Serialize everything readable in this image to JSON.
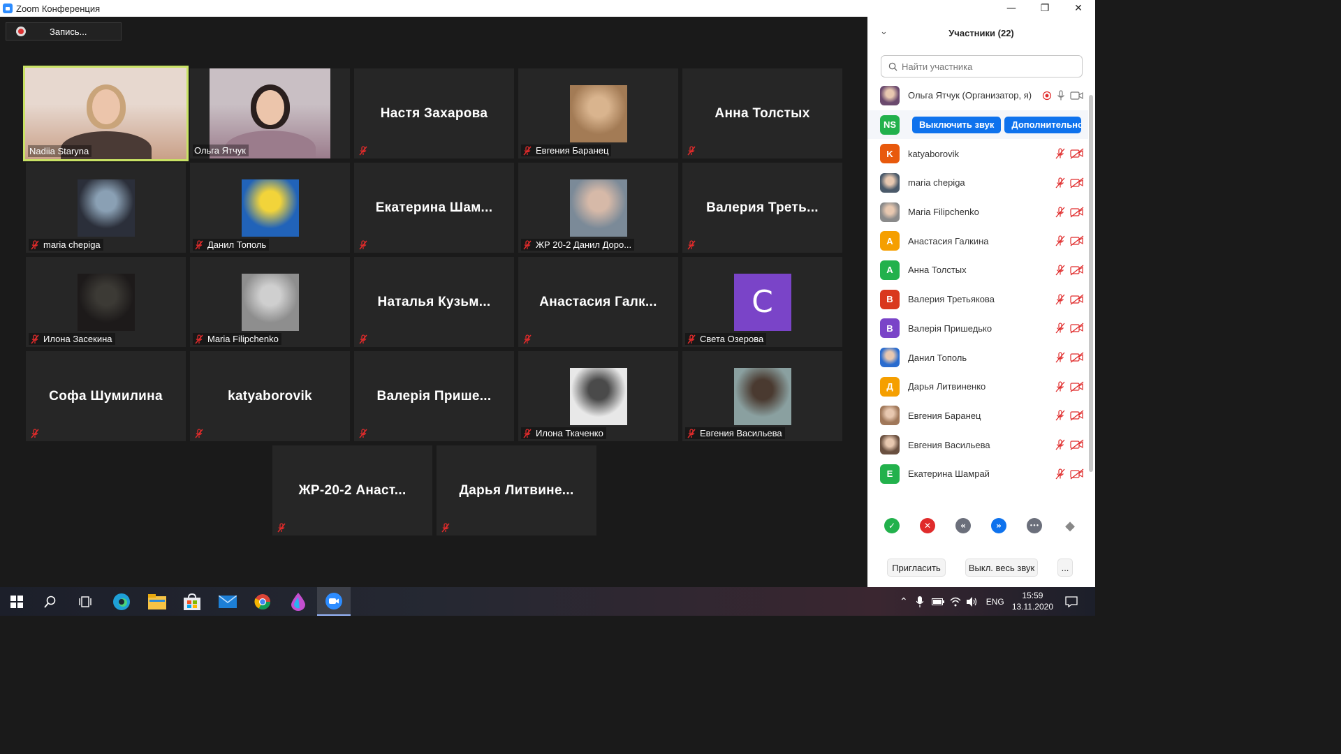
{
  "window": {
    "title": "Zoom Конференция",
    "minimize_glyph": "—",
    "restore_glyph": "❐",
    "close_glyph": "✕"
  },
  "recording": {
    "label": "Запись..."
  },
  "tiles": [
    {
      "id": "nadiia",
      "name": "Nadiia Staryna",
      "type": "video",
      "active": true,
      "muted": false
    },
    {
      "id": "olga",
      "name": "Ольга Ятчук",
      "type": "video",
      "muted": false
    },
    {
      "id": "nastya",
      "name": "Настя Захарова",
      "type": "name",
      "muted": true
    },
    {
      "id": "evgeniya-b",
      "name": "Евгения Баранец",
      "type": "photo",
      "muted": true
    },
    {
      "id": "anna",
      "name": "Анна Толстых",
      "type": "name",
      "muted": true
    },
    {
      "id": "maria-ch",
      "name": "maria chepiga",
      "type": "photo",
      "muted": true
    },
    {
      "id": "danil",
      "name": "Данил Тополь",
      "type": "photo",
      "muted": true
    },
    {
      "id": "ekaterina",
      "name": "Екатерина  Шам...",
      "type": "name",
      "muted": true
    },
    {
      "id": "zhr-danil",
      "name": "ЖР 20-2 Данил Доро...",
      "type": "photo",
      "muted": true
    },
    {
      "id": "valeriya-t",
      "name": "Валерия  Треть...",
      "type": "name",
      "muted": true
    },
    {
      "id": "ilona-z",
      "name": "Илона Засекина",
      "type": "photo",
      "muted": true
    },
    {
      "id": "maria-f",
      "name": "Maria Filipchenko",
      "type": "photo",
      "muted": true
    },
    {
      "id": "natalya",
      "name": "Наталья  Кузьм...",
      "type": "name",
      "muted": true
    },
    {
      "id": "anastasiya-g",
      "name": "Анастасия  Галк...",
      "type": "name",
      "muted": true
    },
    {
      "id": "sveta",
      "name": "Света Озерова",
      "type": "letter",
      "letter": "C",
      "muted": true
    },
    {
      "id": "sofa",
      "name": "Софа Шумилина",
      "type": "name",
      "muted": true
    },
    {
      "id": "katya",
      "name": "katyaborovik",
      "type": "name",
      "muted": true
    },
    {
      "id": "valeriya-p",
      "name": "Валерія  Прише...",
      "type": "name",
      "muted": true
    },
    {
      "id": "ilona-t",
      "name": "Илона Ткаченко",
      "type": "photo",
      "muted": true
    },
    {
      "id": "evgeniya-v",
      "name": "Евгения Васильева",
      "type": "photo",
      "muted": true
    },
    {
      "id": "zhr-anast",
      "name": "ЖР-20-2  Анаст...",
      "type": "name",
      "muted": true
    },
    {
      "id": "darya",
      "name": "Дарья  Литвине...",
      "type": "name",
      "muted": true
    }
  ],
  "panel": {
    "title": "Участники (22)",
    "collapse_glyph": "⌄",
    "search_placeholder": "Найти участника",
    "participants": [
      {
        "name": "Ольга Ятчук (Организатор, я)",
        "avatar": "photo",
        "color": "#6b4a6e",
        "host": true
      },
      {
        "name": "",
        "initials": "NS",
        "avatar": "letter",
        "color": "#22b14c",
        "hovered": true,
        "mute_btn": "Выключить звук",
        "more_btn": "Дополнительно"
      },
      {
        "name": "katyaborovik",
        "initials": "K",
        "avatar": "letter",
        "color": "#e8590c"
      },
      {
        "name": "maria chepiga",
        "avatar": "photo",
        "color": "#4b5a6a"
      },
      {
        "name": "Maria Filipchenko",
        "avatar": "photo",
        "color": "#8a8a8a"
      },
      {
        "name": "Анастасия Галкина",
        "initials": "А",
        "avatar": "letter",
        "color": "#f59f00"
      },
      {
        "name": "Анна Толстых",
        "initials": "А",
        "avatar": "letter",
        "color": "#22b14c"
      },
      {
        "name": "Валерия Третьякова",
        "initials": "В",
        "avatar": "letter",
        "color": "#d9381e"
      },
      {
        "name": "Валерія Пришедько",
        "initials": "В",
        "avatar": "letter",
        "color": "#7a44c8"
      },
      {
        "name": "Данил Тополь",
        "avatar": "photo",
        "color": "#2a6ccf"
      },
      {
        "name": "Дарья Литвиненко",
        "initials": "Д",
        "avatar": "letter",
        "color": "#f59f00"
      },
      {
        "name": "Евгения Баранец",
        "avatar": "photo",
        "color": "#a0785a"
      },
      {
        "name": "Евгения Васильева",
        "avatar": "photo",
        "color": "#6a5040"
      },
      {
        "name": "Екатерина Шамрай",
        "initials": "Е",
        "avatar": "letter",
        "color": "#22b14c"
      }
    ],
    "reactions": [
      {
        "name": "yes",
        "color": "#22b14c",
        "glyph": "✓"
      },
      {
        "name": "no",
        "color": "#e02b2b",
        "glyph": "✕"
      },
      {
        "name": "slower",
        "color": "#6b6f7b",
        "glyph": "«"
      },
      {
        "name": "faster",
        "color": "#0e72ed",
        "glyph": "»"
      },
      {
        "name": "more",
        "color": "#6b6f7b",
        "glyph": "•••"
      },
      {
        "name": "clear",
        "color": "#6b6f7b",
        "glyph": "◆"
      }
    ],
    "footer": {
      "invite": "Пригласить",
      "mute_all": "Выкл. весь звук",
      "more": "..."
    }
  },
  "taskbar": {
    "language": "ENG",
    "time": "15:59",
    "date": "13.11.2020"
  }
}
